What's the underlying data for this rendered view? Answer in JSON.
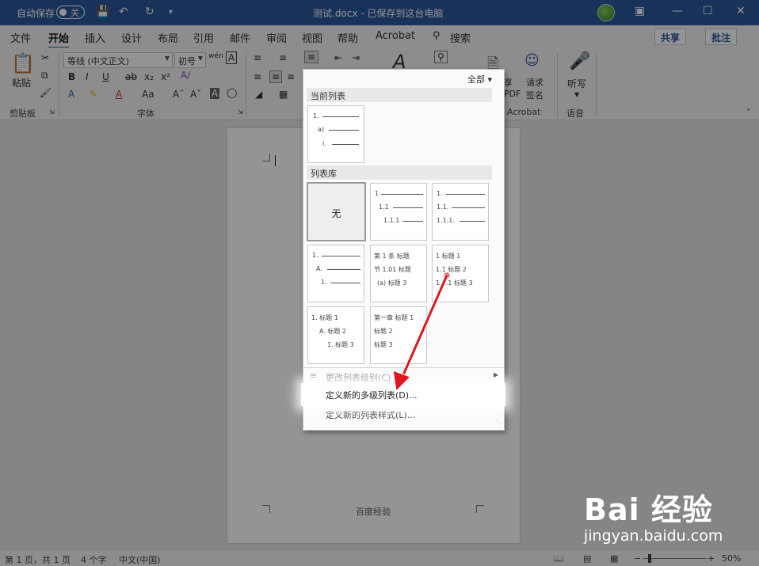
{
  "titlebar": {
    "autosave_label": "自动保存",
    "autosave_state": "关",
    "doc_title": "测试.docx - 已保存到这台电脑"
  },
  "tabs": [
    "文件",
    "开始",
    "插入",
    "设计",
    "布局",
    "引用",
    "邮件",
    "审阅",
    "视图",
    "帮助",
    "Acrobat",
    "搜索"
  ],
  "active_tab": "开始",
  "share_label": "共享",
  "comment_label": "批注",
  "ribbon": {
    "paste_label": "粘贴",
    "font_name": "等线 (中文正文)",
    "font_size": "初号",
    "groups": {
      "clipboard": "剪贴板",
      "font": "字体",
      "acrobat": "Acrobat",
      "voice": "语音"
    },
    "create_pdf_label": "共享\nPDF",
    "request_sign_label": "请求\n签名",
    "dictate_label": "听写"
  },
  "dropdown": {
    "filter_label": "全部",
    "current_list_heading": "当前列表",
    "library_heading": "列表库",
    "none_label": "无",
    "current_list_thumb": [
      "1.",
      "a)",
      "i."
    ],
    "library": [
      {
        "lines": [
          "1",
          "1.1",
          "1.1.1"
        ]
      },
      {
        "lines": [
          "1.",
          "1.1.",
          "1.1.1."
        ]
      },
      {
        "lines": [
          "1.",
          "A.",
          "1."
        ]
      },
      {
        "lines": [
          "第 1 条 标题",
          "节 1.01 标题",
          "(a) 标题 3"
        ]
      },
      {
        "lines": [
          "1 标题 1",
          "1.1 标题 2",
          "1.1.1 标题 3"
        ]
      },
      {
        "lines": [
          "1. 标题 1",
          "A. 标题 2",
          "1. 标题 3"
        ]
      },
      {
        "lines": [
          "第一章 标题 1",
          "标题 2",
          "标题 3"
        ]
      }
    ],
    "change_level_label": "更改列表级别(C)",
    "define_new_multilevel": "定义新的多级列表(D)...",
    "define_new_style": "定义新的列表样式(L)..."
  },
  "document": {
    "footer_text": "百度经验"
  },
  "statusbar": {
    "page_info": "第 1 页，共 1 页",
    "word_count": "4 个字",
    "language": "中文(中国)",
    "zoom": "50%"
  },
  "watermark": {
    "logo": "Bai 经验",
    "url": "jingyan.baidu.com"
  },
  "colors": {
    "titlebar": "#2b579a",
    "arrow": "#e0161c"
  }
}
